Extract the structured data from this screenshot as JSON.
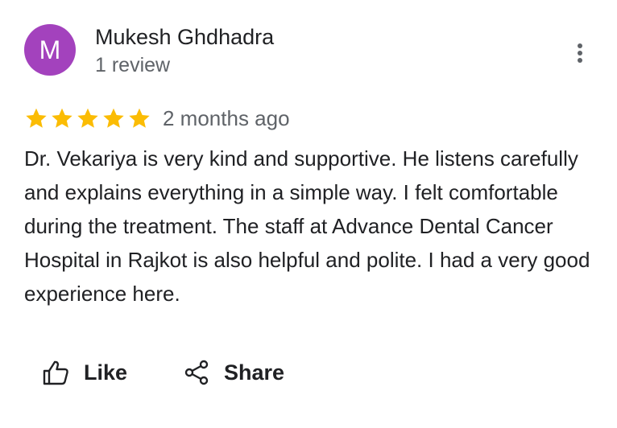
{
  "review": {
    "author": {
      "initial": "M",
      "name": "Mukesh Ghdhadra",
      "review_count": "1 review",
      "avatar_color": "#a342bd"
    },
    "rating": 5,
    "max_rating": 5,
    "star_color": "#fbbc04",
    "date": "2 months ago",
    "text": "Dr. Vekariya is very kind and supportive. He listens carefully and explains everything in a simple way. I felt comfortable during the treatment. The staff at Advance Dental Cancer Hospital in Rajkot is also helpful and polite. I had a very good experience here."
  },
  "menu": {
    "icon": "more-vert-icon"
  },
  "actions": {
    "like": {
      "label": "Like",
      "icon": "thumb-up-icon"
    },
    "share": {
      "label": "Share",
      "icon": "share-icon"
    }
  }
}
